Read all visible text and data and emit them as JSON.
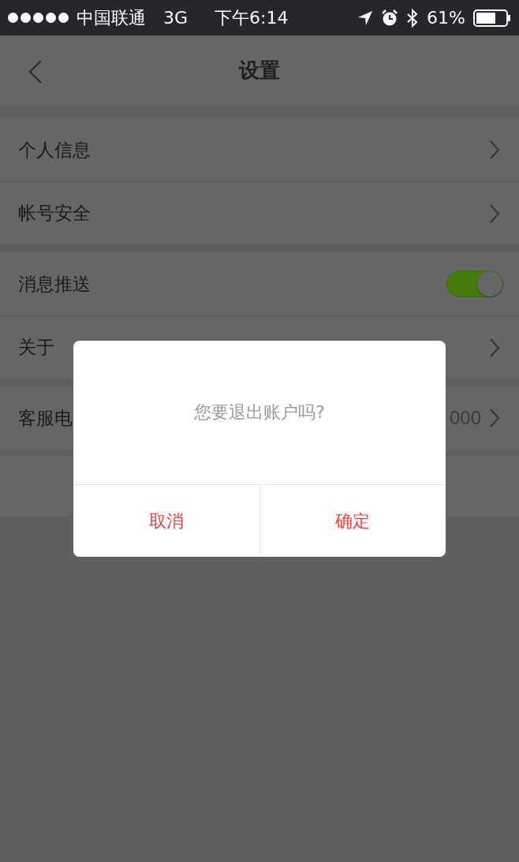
{
  "status_bar": {
    "carrier": "中国联通",
    "network": "3G",
    "time": "下午6:14",
    "battery": "61%"
  },
  "nav": {
    "title": "设置"
  },
  "groups": [
    {
      "rows": [
        {
          "label": "个人信息",
          "kind": "link"
        },
        {
          "label": "帐号安全",
          "kind": "link"
        }
      ]
    },
    {
      "rows": [
        {
          "label": "消息推送",
          "kind": "toggle",
          "on": true
        },
        {
          "label": "关于",
          "kind": "link"
        }
      ]
    },
    {
      "rows": [
        {
          "label": "客服电",
          "kind": "link",
          "value": "000"
        }
      ]
    }
  ],
  "dialog": {
    "message": "您要退出账户吗?",
    "buttons": [
      {
        "label": "取消"
      },
      {
        "label": "确定"
      }
    ]
  }
}
